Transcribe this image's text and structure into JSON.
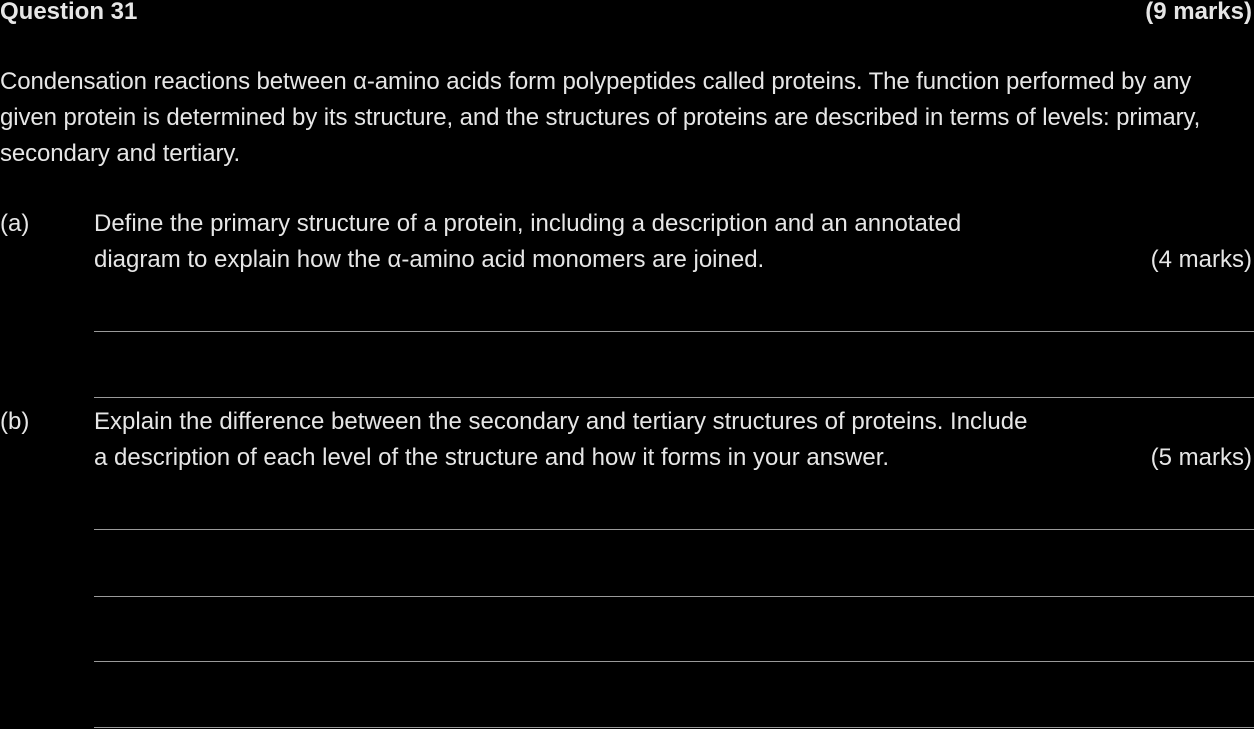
{
  "question": {
    "title": "Question 31",
    "marks": "(9 marks)"
  },
  "intro": {
    "text": "Condensation reactions between α-amino acids form polypeptides called proteins. The function performed by any given protein is determined by its structure, and the structures of proteins are described in terms of levels: primary, secondary and tertiary."
  },
  "parts": [
    {
      "label": "(a)",
      "line1": "Define the primary structure of a protein, including a description and an annotated",
      "line2": "diagram to explain how the α-amino acid monomers are joined.",
      "marks": "(4 marks)"
    },
    {
      "label": "(b)",
      "line1": "Explain the difference between the secondary and tertiary structures of proteins. Include",
      "line2": "a description of each level of the structure and how it forms in your answer.",
      "marks": "(5 marks)"
    }
  ],
  "colors": {
    "background": "#000000",
    "text": "#e6e6e6",
    "answer_line": "#9a9a9a"
  }
}
